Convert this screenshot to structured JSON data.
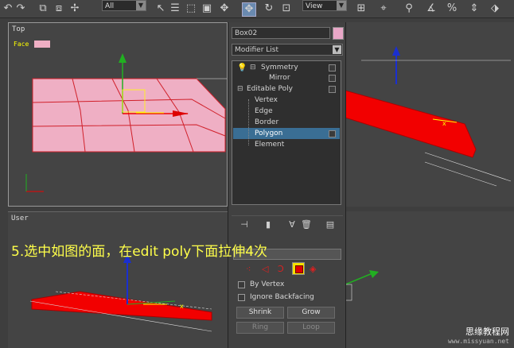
{
  "toolbar": {
    "selection_filter": "All",
    "ref_coord": "View"
  },
  "viewports": {
    "top": {
      "label": "Top",
      "face_label": "Face"
    },
    "user": {
      "label": "User"
    }
  },
  "command_panel": {
    "object_name": "Box02",
    "object_color": "#e8a7c7",
    "modifier_list": "Modifier List",
    "stack": {
      "symmetry": "Symmetry",
      "mirror": "Mirror",
      "editable_poly": "Editable Poly",
      "vertex": "Vertex",
      "edge": "Edge",
      "border": "Border",
      "polygon": "Polygon",
      "element": "Element"
    },
    "selection": {
      "by_vertex": "By Vertex",
      "ignore_backfacing": "Ignore Backfacing",
      "shrink": "Shrink",
      "grow": "Grow",
      "ring": "Ring",
      "loop": "Loop"
    }
  },
  "caption": "5.选中如图的面，在edit poly下面拉伸4次",
  "watermark": {
    "line1": "思缘教程网",
    "line2": "www.missyuan.net"
  },
  "colors": {
    "selected_face": "#ff0000",
    "unselected_face": "#efafc4",
    "highlight": "#3a6e94"
  }
}
